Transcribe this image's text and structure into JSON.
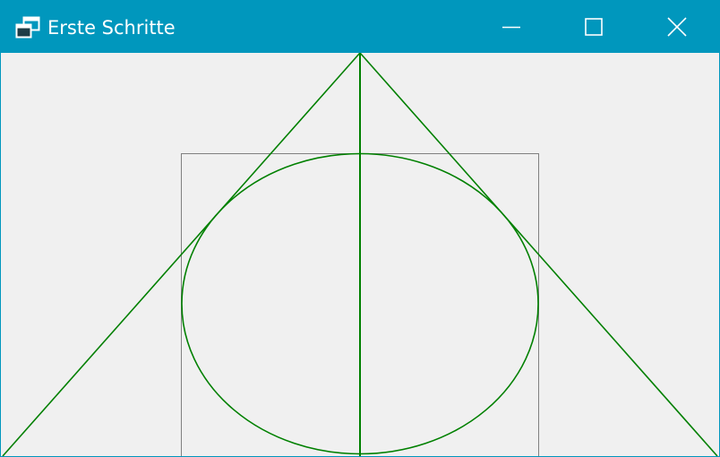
{
  "window": {
    "title": "Erste Schritte",
    "icons": {
      "app": "app-window-icon",
      "minimize": "minimize-icon",
      "maximize": "maximize-icon",
      "close": "close-icon"
    }
  },
  "colors": {
    "titlebar": "#0097BD",
    "client_background": "#F0F0F0",
    "shape_stroke": "#008000",
    "rectangle_stroke": "#808080"
  },
  "drawing": {
    "shapes": [
      "triangle",
      "vertical-line",
      "ellipse",
      "bounding-rectangle"
    ]
  }
}
